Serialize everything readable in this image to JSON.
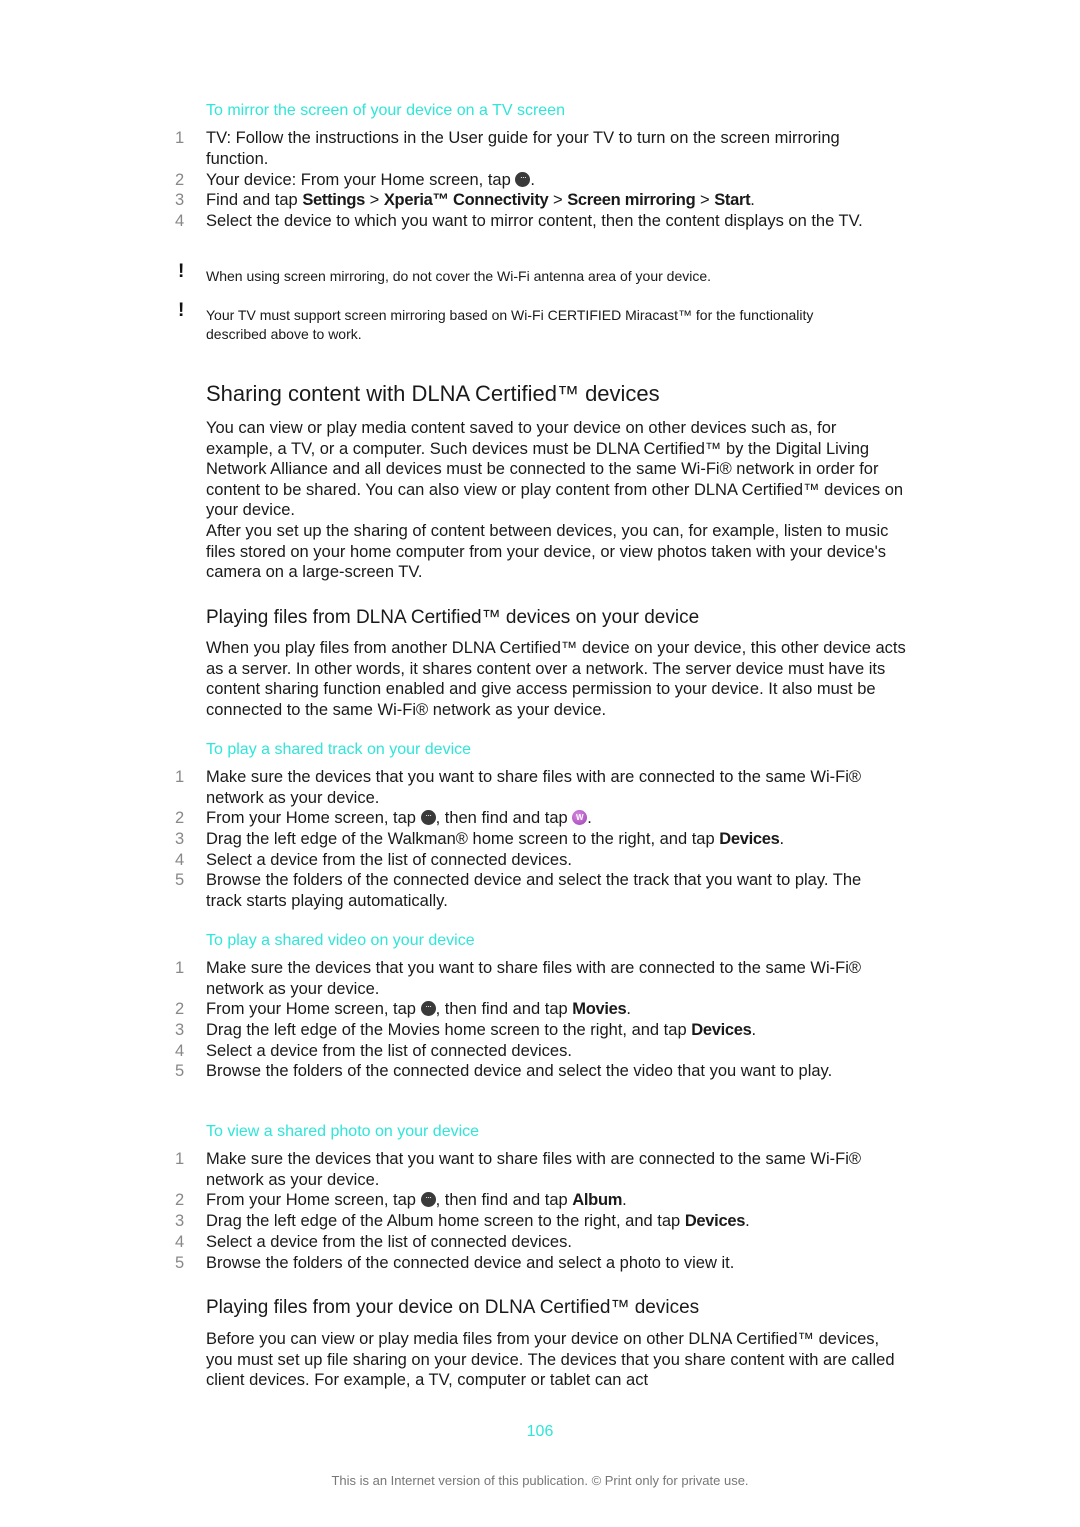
{
  "mirror": {
    "title": "To mirror the screen of your device on a TV screen",
    "steps": [
      {
        "num": "1",
        "text": "TV: Follow the instructions in the User guide for your TV to turn on the screen mirroring function."
      },
      {
        "num": "2",
        "pre": "Your device: From your Home screen, tap ",
        "icon": "apps-icon",
        "post": "."
      },
      {
        "num": "3",
        "pre": "Find and tap ",
        "b1": "Settings",
        "s1": " > ",
        "b2": "Xperia™ Connectivity",
        "s2": " > ",
        "b3": "Screen mirroring",
        "s3": " > ",
        "b4": "Start",
        "post": "."
      },
      {
        "num": "4",
        "text": "Select the device to which you want to mirror content, then the content displays on the TV."
      }
    ],
    "notes": [
      {
        "icon": "!",
        "text": "When using screen mirroring, do not cover the Wi-Fi antenna area of your device."
      },
      {
        "icon": "!",
        "text": "Your TV must support screen mirroring based on Wi-Fi CERTIFIED Miracast™ for the functionality described above to work."
      }
    ]
  },
  "sharing": {
    "heading": "Sharing content with DLNA Certified™ devices",
    "para1": "You can view or play media content saved to your device on other devices such as, for example, a TV, or a computer. Such devices must be DLNA Certified™ by the Digital Living Network Alliance and all devices must be connected to the same Wi-Fi® network in order for content to be shared. You can also view or play content from other DLNA Certified™ devices on your device.",
    "para2": "After you set up the sharing of content between devices, you can, for example, listen to music files stored on your home computer from your device, or view photos taken with your device's camera on a large-screen TV."
  },
  "playing_from": {
    "heading": "Playing files from DLNA Certified™ devices on your device",
    "para": "When you play files from another DLNA Certified™ device on your device, this other device acts as a server. In other words, it shares content over a network. The server device must have its content sharing function enabled and give access permission to your device. It also must be connected to the same Wi-Fi® network as your device."
  },
  "track": {
    "title": "To play a shared track on your device",
    "steps": [
      {
        "num": "1",
        "text": "Make sure the devices that you want to share files with are connected to the same Wi-Fi® network as your device."
      },
      {
        "num": "2",
        "pre": "From your Home screen, tap ",
        "mid": ", then find and tap ",
        "post": "."
      },
      {
        "num": "3",
        "pre": "Drag the left edge of the Walkman® home screen to the right, and tap ",
        "bold": "Devices",
        "post": "."
      },
      {
        "num": "4",
        "text": "Select a device from the list of connected devices."
      },
      {
        "num": "5",
        "text": "Browse the folders of the connected device and select the track that you want to play. The track starts playing automatically."
      }
    ]
  },
  "video": {
    "title": "To play a shared video on your device",
    "steps": [
      {
        "num": "1",
        "text": "Make sure the devices that you want to share files with are connected to the same Wi-Fi® network as your device."
      },
      {
        "num": "2",
        "pre": "From your Home screen, tap ",
        "mid": ", then find and tap ",
        "bold": "Movies",
        "post": "."
      },
      {
        "num": "3",
        "pre": "Drag the left edge of the Movies home screen to the right, and tap ",
        "bold": "Devices",
        "post": "."
      },
      {
        "num": "4",
        "text": "Select a device from the list of connected devices."
      },
      {
        "num": "5",
        "text": "Browse the folders of the connected device and select the video that you want to play."
      }
    ]
  },
  "photo": {
    "title": "To view a shared photo on your device",
    "steps": [
      {
        "num": "1",
        "text": "Make sure the devices that you want to share files with are connected to the same Wi-Fi® network as your device."
      },
      {
        "num": "2",
        "pre": "From your Home screen, tap ",
        "mid": ", then find and tap ",
        "bold": "Album",
        "post": "."
      },
      {
        "num": "3",
        "pre": "Drag the left edge of the Album home screen to the right, and tap ",
        "bold": "Devices",
        "post": "."
      },
      {
        "num": "4",
        "text": "Select a device from the list of connected devices."
      },
      {
        "num": "5",
        "text": "Browse the folders of the connected device and select a photo to view it."
      }
    ]
  },
  "playing_to": {
    "heading": "Playing files from your device on DLNA Certified™ devices",
    "para": "Before you can view or play media files from your device on other DLNA Certified™ devices, you must set up file sharing on your device. The devices that you share content with are called client devices. For example, a TV, computer or tablet can act"
  },
  "page": {
    "number": "106",
    "footer": "This is an Internet version of this publication. © Print only for private use."
  },
  "colors": {
    "accent": "#2fe6d8",
    "text": "#1a1a1a",
    "step_number": "#888888",
    "footer": "#777777"
  }
}
